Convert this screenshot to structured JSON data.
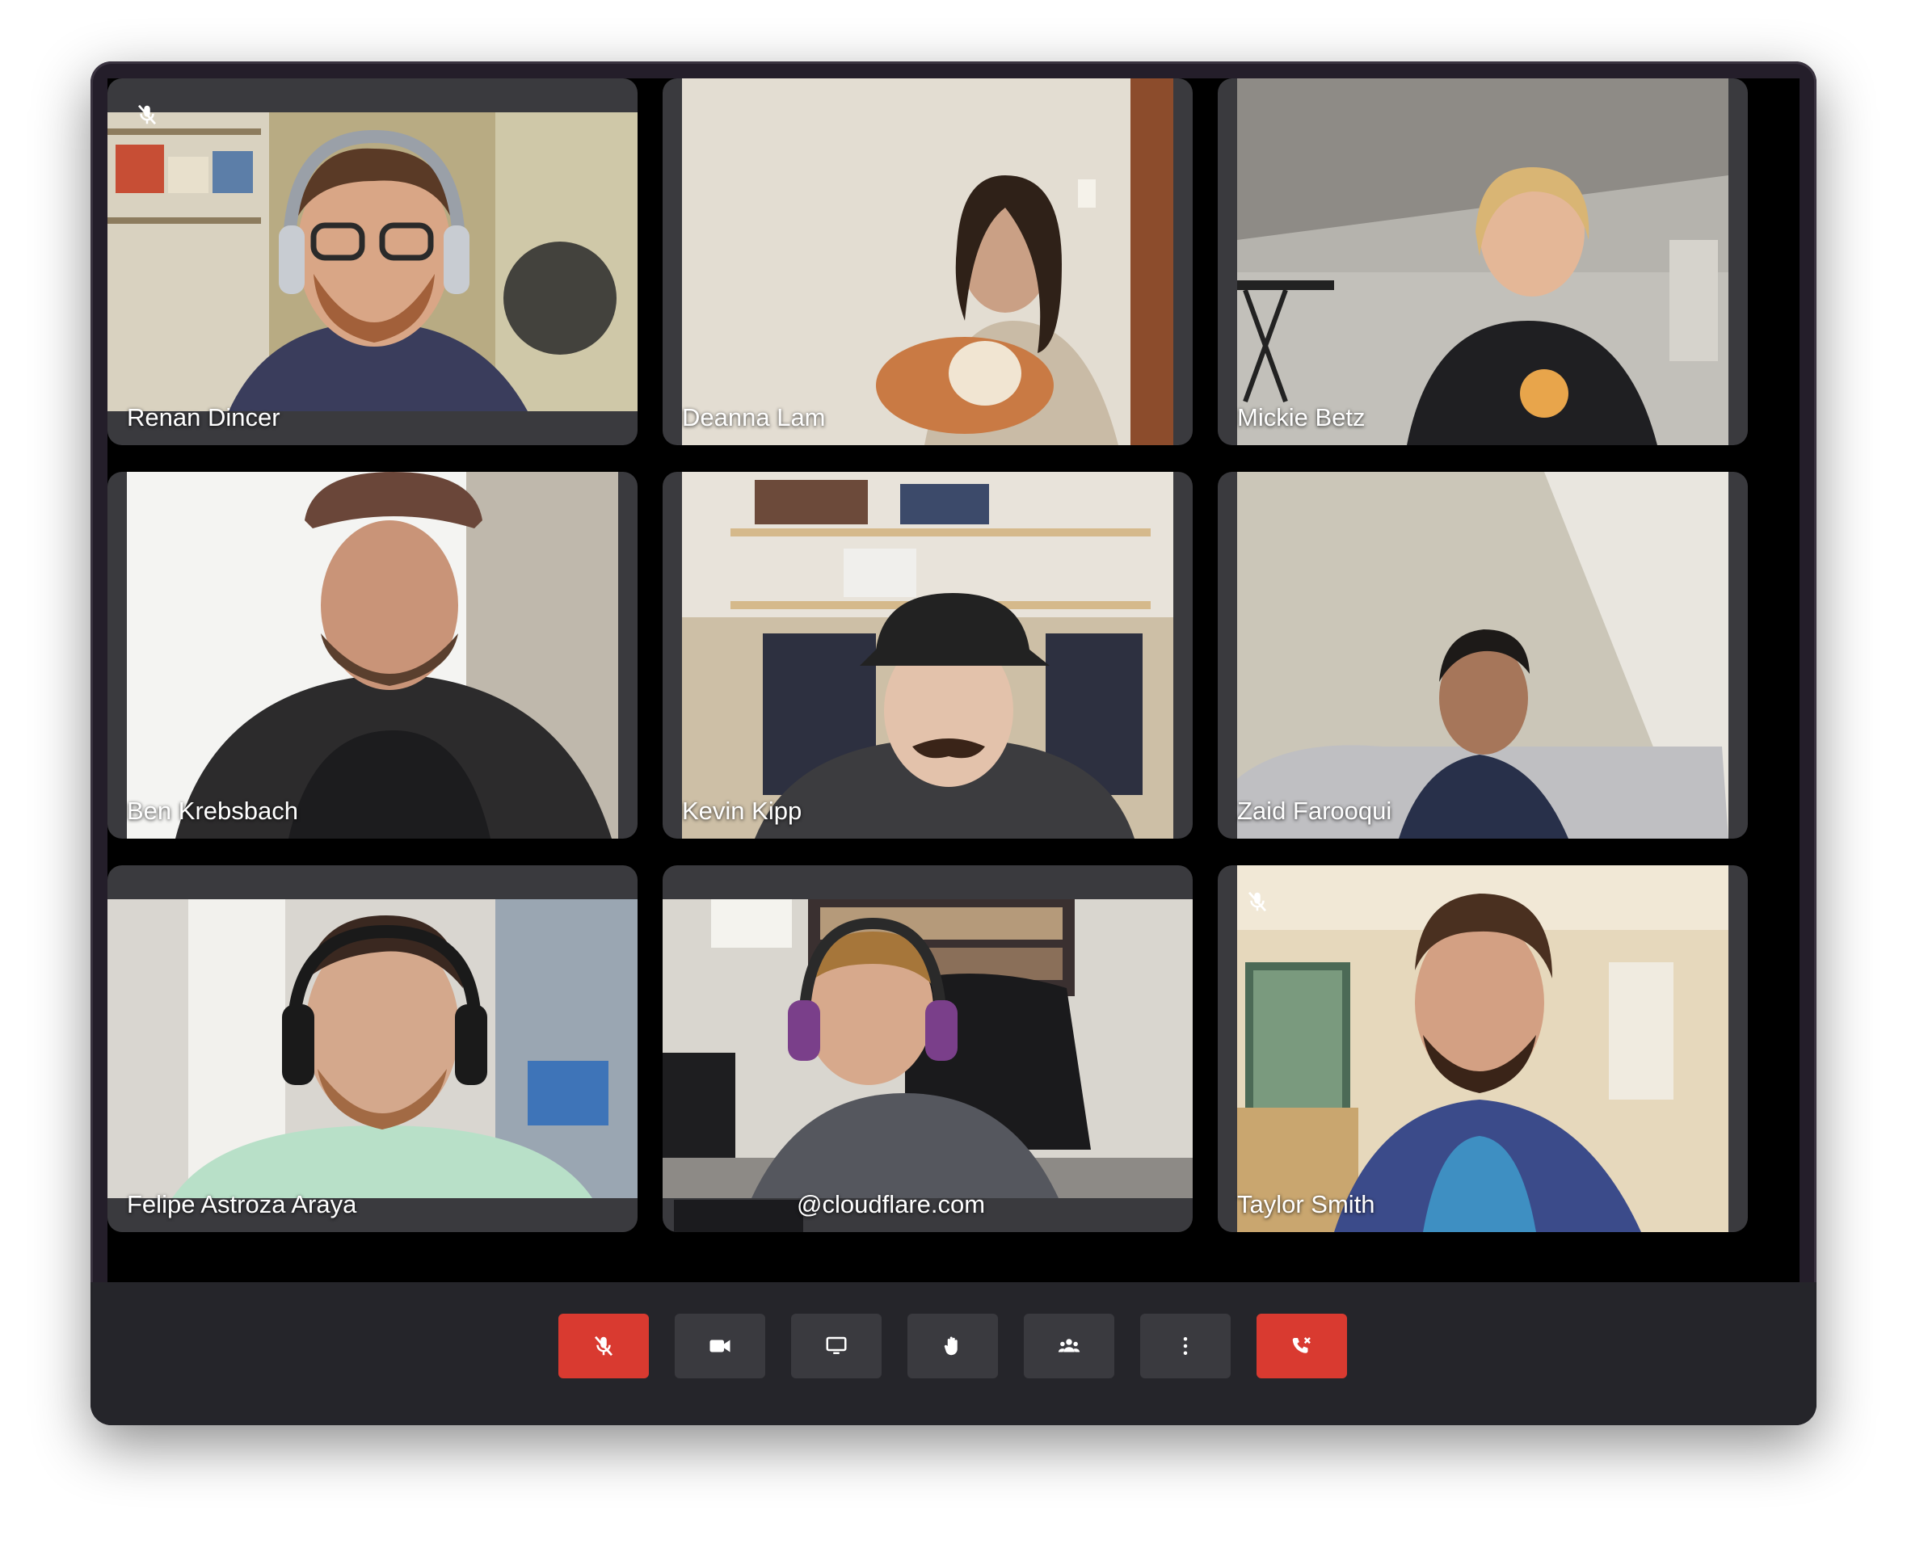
{
  "participants": [
    {
      "name": "Renan Dincer",
      "muted": true
    },
    {
      "name": "Deanna Lam",
      "muted": false
    },
    {
      "name": "Mickie Betz",
      "muted": false
    },
    {
      "name": "Ben Krebsbach",
      "muted": false
    },
    {
      "name": "Kevin Kipp",
      "muted": false
    },
    {
      "name": "Zaid Farooqui",
      "muted": false
    },
    {
      "name": "Felipe Astroza Araya",
      "muted": false
    },
    {
      "name": "@cloudflare.com",
      "muted": false
    },
    {
      "name": "Taylor Smith",
      "muted": true
    }
  ],
  "toolbar": {
    "buttons": [
      {
        "icon": "microphone-off-icon",
        "state": "muted"
      },
      {
        "icon": "video-camera-icon"
      },
      {
        "icon": "screen-share-icon"
      },
      {
        "icon": "raise-hand-icon"
      },
      {
        "icon": "participants-icon"
      },
      {
        "icon": "more-options-icon"
      },
      {
        "icon": "leave-call-icon"
      }
    ]
  },
  "colors": {
    "danger": "#d93a30",
    "button": "#3a3a3f",
    "toolbar_bg": "#25252a",
    "stage_bg": "#000000"
  }
}
